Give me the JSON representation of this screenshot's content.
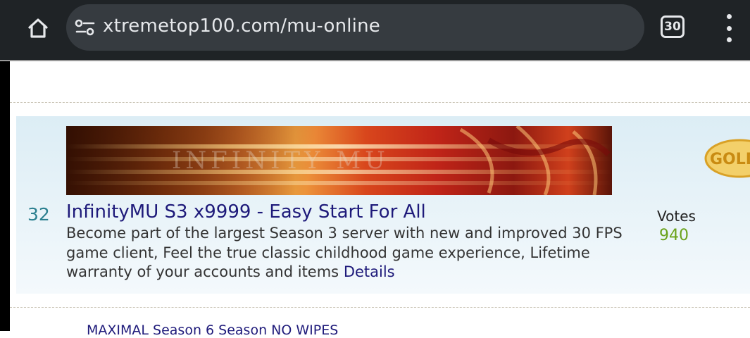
{
  "browser": {
    "url": "xtremetop100.com/mu-online",
    "tab_count": "30",
    "icons": {
      "home": "home-icon",
      "site_info": "site-settings-icon",
      "menu": "more-vert-icon"
    }
  },
  "listing": {
    "rank": "32",
    "title": "InfinityMU S3 x9999 - Easy Start For All",
    "description": "Become part of the largest Season 3 server with new and improved 30 FPS game client, Feel the true classic childhood game experience, Lifetime warranty of your accounts and items",
    "details_label": "Details",
    "votes_label": "Votes",
    "votes_count": "940",
    "banner_text": "INFINITY MU",
    "badge_text": "GOLD"
  },
  "next_listing": {
    "title_partial": "MAXIMAL Season 6 Season NO WIPES"
  },
  "colors": {
    "browser_bar": "#1f2326",
    "url_pill": "#363b40",
    "link": "#1e1a7a",
    "rank": "#2a7f8f",
    "votes": "#6aa21a"
  }
}
